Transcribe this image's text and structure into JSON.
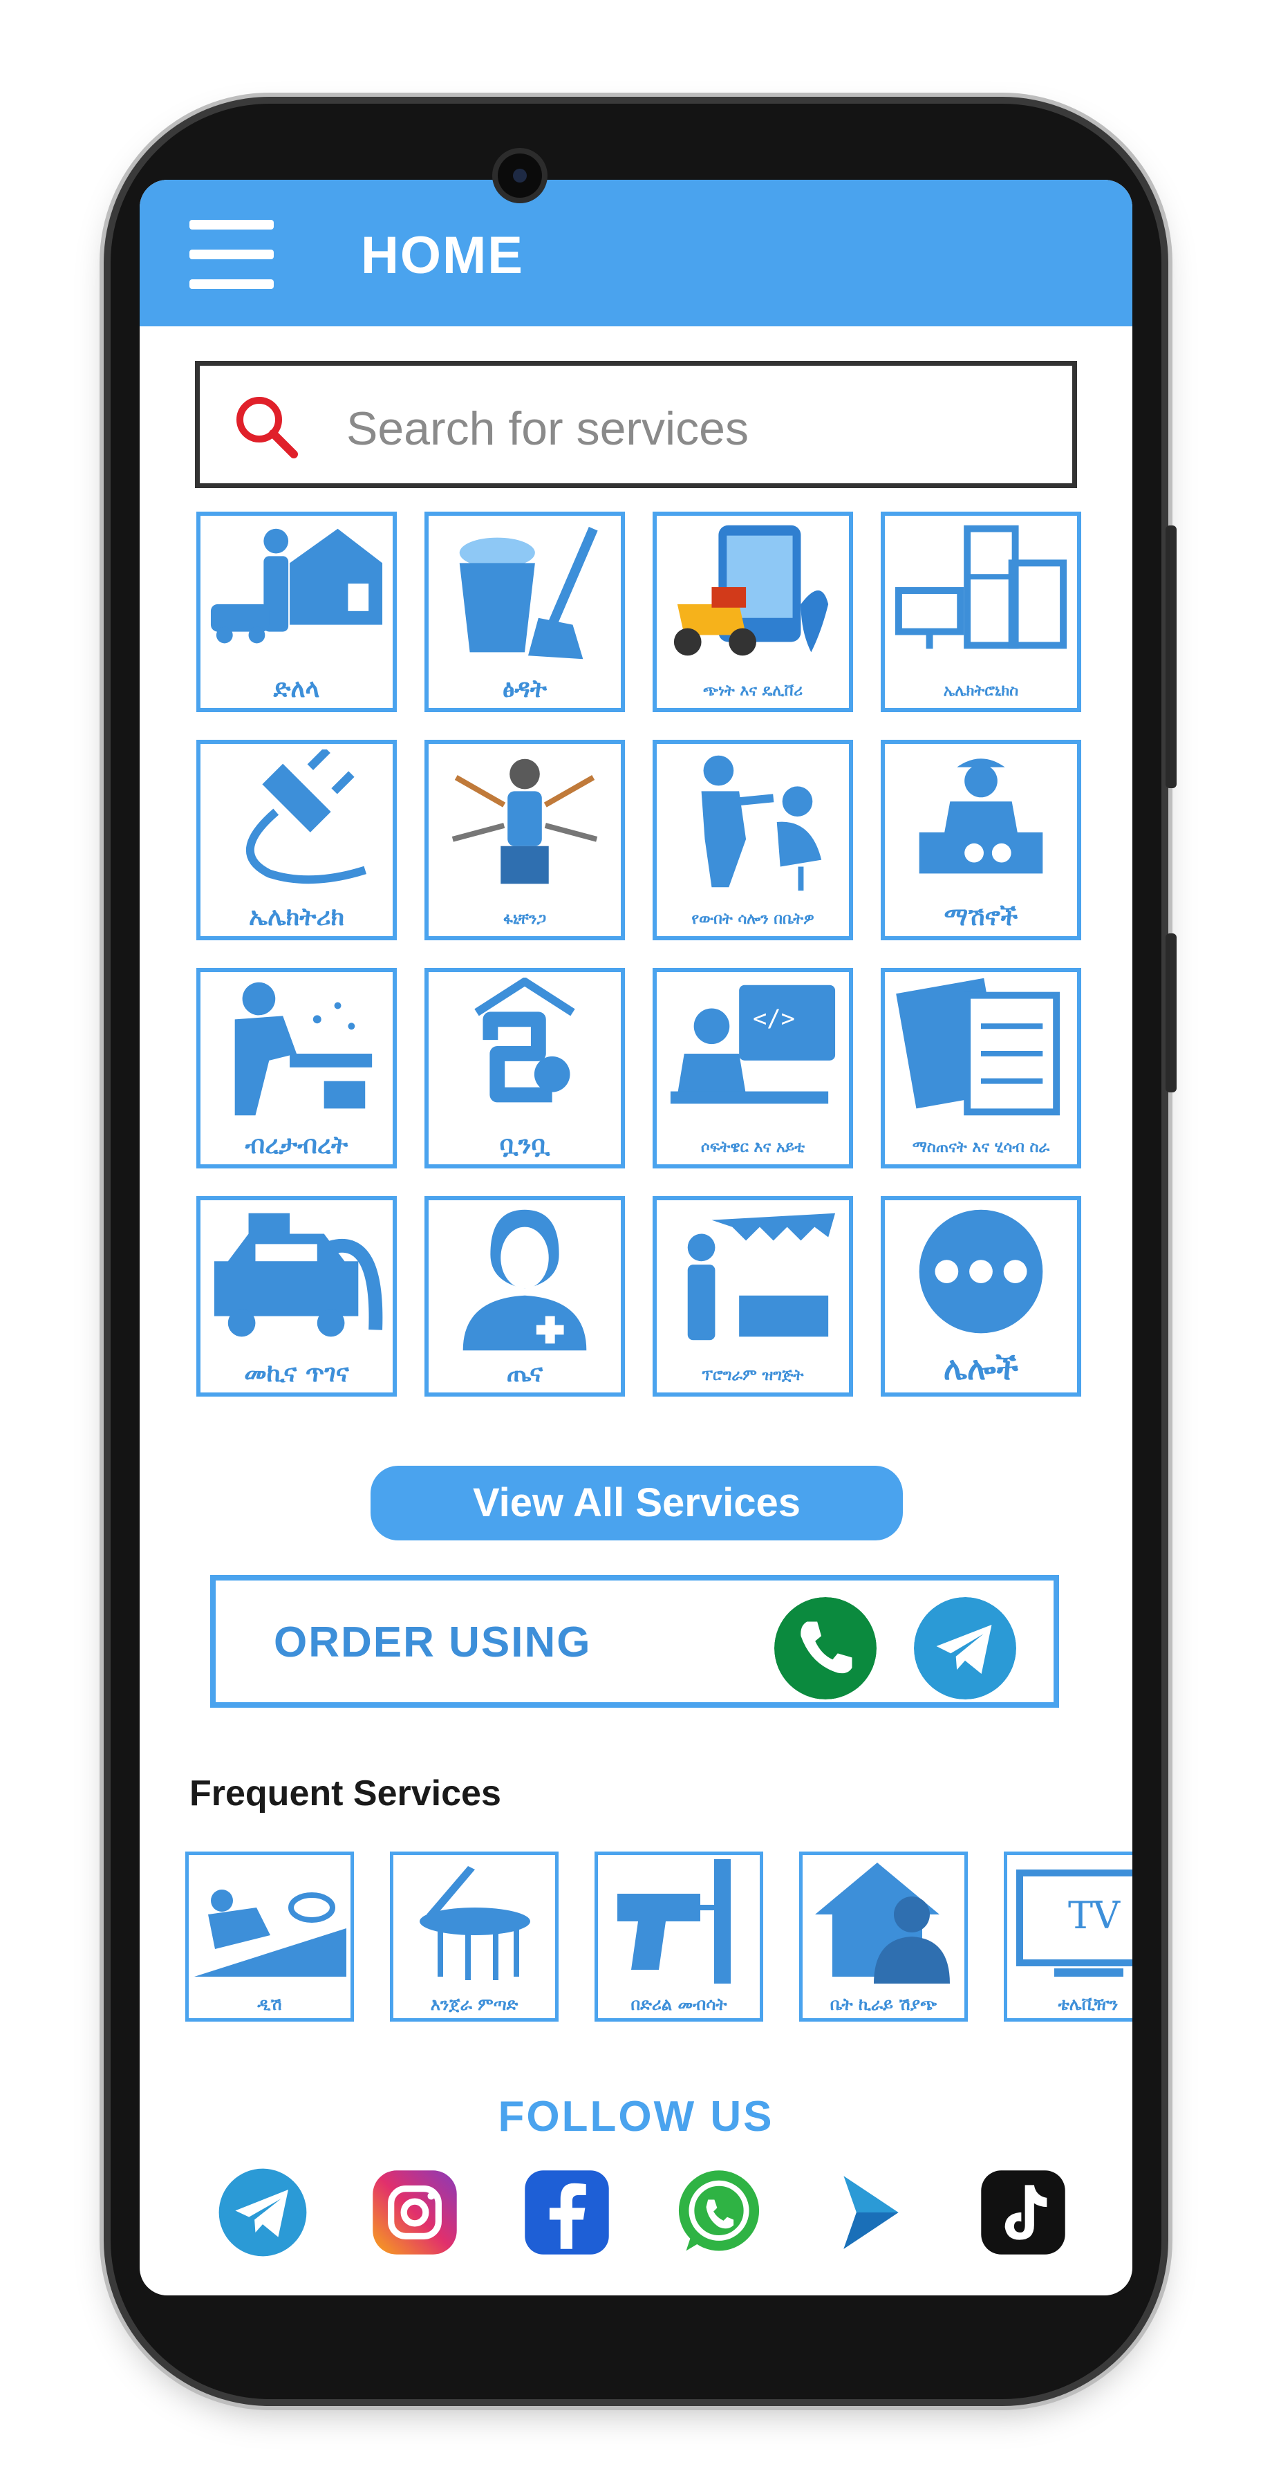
{
  "appbar": {
    "title": "HOME",
    "color": "#4aa3ee"
  },
  "icons": {
    "menu": "hamburger-menu-icon",
    "search": "magnifier-icon"
  },
  "search": {
    "placeholder": "Search for services",
    "value": ""
  },
  "services": [
    {
      "label": "ድለላ",
      "icon": "broker-house-car-icon"
    },
    {
      "label": "ፅዳት",
      "icon": "cleaning-bucket-broom-icon"
    },
    {
      "label": "ጭነት እና ዴሊቨሪ",
      "icon": "delivery-scooter-icon"
    },
    {
      "label": "ኤሌክትሮኒክስ",
      "icon": "electronics-appliances-icon"
    },
    {
      "label": "ኤሌክትሪክ",
      "icon": "electric-plug-icon"
    },
    {
      "label": "ፋኒቸንጋ",
      "icon": "multi-tool-worker-icon"
    },
    {
      "label": "የውበት ሳሎን በቤትዎ",
      "icon": "hairdresser-icon"
    },
    {
      "label": "ማሽኖች",
      "icon": "machine-engineer-icon"
    },
    {
      "label": "ብረታብረት",
      "icon": "welder-icon"
    },
    {
      "label": "ቧንቧ",
      "icon": "plumbing-pipes-icon"
    },
    {
      "label": "ሶፍትዌር እና አይቲ",
      "icon": "software-developer-icon"
    },
    {
      "label": "ማስጠናት እና ሂሳብ ስራ",
      "icon": "tutoring-accounting-icon"
    },
    {
      "label": "መኪና ጥገና",
      "icon": "car-repair-icon"
    },
    {
      "label": "ጤና",
      "icon": "doctor-icon"
    },
    {
      "label": "ፕሮግራም ዝግጅት",
      "icon": "event-planning-icon"
    },
    {
      "label": "ሌሎች",
      "icon": "more-dots-icon"
    }
  ],
  "view_all": {
    "label": "View All Services"
  },
  "order": {
    "label": "ORDER USING",
    "phone_color": "#0b8a3e",
    "telegram_color": "#2b9ad6"
  },
  "frequent": {
    "title": "Frequent Services",
    "items": [
      {
        "label": "ዲሽ",
        "icon": "satellite-dish-installer-icon"
      },
      {
        "label": "እንጀራ ምጣድ",
        "icon": "injera-mitad-icon"
      },
      {
        "label": "በድሪል መብሳት",
        "icon": "drill-icon"
      },
      {
        "label": "ቤት ኪራይ ሽያጭ",
        "icon": "house-agent-icon"
      },
      {
        "label": "ቴሌቪዥን",
        "icon": "tv-icon"
      }
    ]
  },
  "follow": {
    "title": "FOLLOW US",
    "networks": [
      "telegram-icon",
      "instagram-icon",
      "facebook-icon",
      "whatsapp-icon",
      "twitter-icon",
      "tiktok-icon"
    ]
  }
}
